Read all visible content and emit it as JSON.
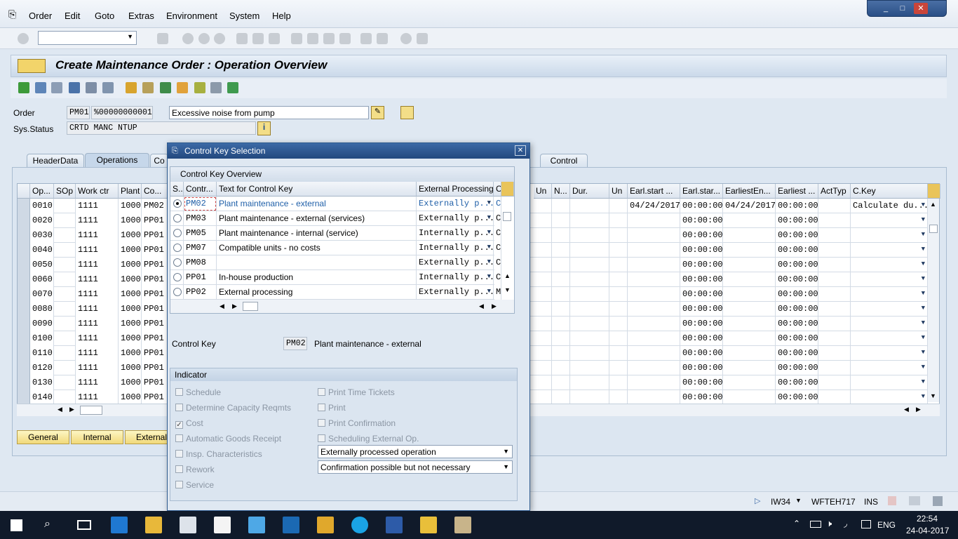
{
  "menu": [
    "Order",
    "Edit",
    "Goto",
    "Extras",
    "Environment",
    "System",
    "Help"
  ],
  "window_controls": [
    "_",
    "□",
    "✕"
  ],
  "page_title": "Create Maintenance Order : Operation Overview",
  "header": {
    "order_label": "Order",
    "order_type": "PM01",
    "order_number": "%00000000001",
    "order_desc": "Excessive noise from pump",
    "status_label": "Sys.Status",
    "status_value": "CRTD MANC NTUP"
  },
  "tabs": [
    "HeaderData",
    "Operations",
    "Co",
    "Control"
  ],
  "grid": {
    "columns": [
      "Op...",
      "SOp",
      "Work ctr",
      "Plant",
      "Co...",
      "Un",
      "N...",
      "Dur.",
      "Un",
      "Earl.start ...",
      "Earl.star...",
      "EarliestEn...",
      "Earliest ...",
      "ActTyp",
      "C.Key"
    ],
    "rows": [
      {
        "op": "0010",
        "wc": "1111",
        "plant": "1000",
        "ck": "PM02",
        "es": "04/24/2017",
        "est": "00:00:00",
        "ee": "04/24/2017",
        "eet": "00:00:00",
        "calc": "Calculate du..."
      },
      {
        "op": "0020",
        "wc": "1111",
        "plant": "1000",
        "ck": "PP01",
        "es": "",
        "est": "00:00:00",
        "ee": "",
        "eet": "00:00:00",
        "calc": ""
      },
      {
        "op": "0030",
        "wc": "1111",
        "plant": "1000",
        "ck": "PP01",
        "es": "",
        "est": "00:00:00",
        "ee": "",
        "eet": "00:00:00",
        "calc": ""
      },
      {
        "op": "0040",
        "wc": "1111",
        "plant": "1000",
        "ck": "PP01",
        "es": "",
        "est": "00:00:00",
        "ee": "",
        "eet": "00:00:00",
        "calc": ""
      },
      {
        "op": "0050",
        "wc": "1111",
        "plant": "1000",
        "ck": "PP01",
        "es": "",
        "est": "00:00:00",
        "ee": "",
        "eet": "00:00:00",
        "calc": ""
      },
      {
        "op": "0060",
        "wc": "1111",
        "plant": "1000",
        "ck": "PP01",
        "es": "",
        "est": "00:00:00",
        "ee": "",
        "eet": "00:00:00",
        "calc": ""
      },
      {
        "op": "0070",
        "wc": "1111",
        "plant": "1000",
        "ck": "PP01",
        "es": "",
        "est": "00:00:00",
        "ee": "",
        "eet": "00:00:00",
        "calc": ""
      },
      {
        "op": "0080",
        "wc": "1111",
        "plant": "1000",
        "ck": "PP01",
        "es": "",
        "est": "00:00:00",
        "ee": "",
        "eet": "00:00:00",
        "calc": ""
      },
      {
        "op": "0090",
        "wc": "1111",
        "plant": "1000",
        "ck": "PP01",
        "es": "",
        "est": "00:00:00",
        "ee": "",
        "eet": "00:00:00",
        "calc": ""
      },
      {
        "op": "0100",
        "wc": "1111",
        "plant": "1000",
        "ck": "PP01",
        "es": "",
        "est": "00:00:00",
        "ee": "",
        "eet": "00:00:00",
        "calc": ""
      },
      {
        "op": "0110",
        "wc": "1111",
        "plant": "1000",
        "ck": "PP01",
        "es": "",
        "est": "00:00:00",
        "ee": "",
        "eet": "00:00:00",
        "calc": ""
      },
      {
        "op": "0120",
        "wc": "1111",
        "plant": "1000",
        "ck": "PP01",
        "es": "",
        "est": "00:00:00",
        "ee": "",
        "eet": "00:00:00",
        "calc": ""
      },
      {
        "op": "0130",
        "wc": "1111",
        "plant": "1000",
        "ck": "PP01",
        "es": "",
        "est": "00:00:00",
        "ee": "",
        "eet": "00:00:00",
        "calc": ""
      },
      {
        "op": "0140",
        "wc": "1111",
        "plant": "1000",
        "ck": "PP01",
        "es": "",
        "est": "00:00:00",
        "ee": "",
        "eet": "00:00:00",
        "calc": ""
      }
    ]
  },
  "bottom_buttons": [
    "General",
    "Internal",
    "External"
  ],
  "dialog": {
    "title": "Control Key Selection",
    "close": "✕",
    "overview_title": "Control Key Overview",
    "columns": [
      "S..",
      "Contr...",
      "Text for Control Key",
      "External Processing",
      "C"
    ],
    "rows": [
      {
        "key": "PM02",
        "text": "Plant maintenance - external",
        "ext": "Externally p...",
        "c": "C",
        "selected": true
      },
      {
        "key": "PM03",
        "text": "Plant maintenance - external (services)",
        "ext": "Externally p...",
        "c": "C",
        "selected": false
      },
      {
        "key": "PM05",
        "text": "Plant maintenance - internal (service)",
        "ext": "Internally p...",
        "c": "C",
        "selected": false
      },
      {
        "key": "PM07",
        "text": "Compatible units - no costs",
        "ext": "Internally p...",
        "c": "C",
        "selected": false
      },
      {
        "key": "PM08",
        "text": "",
        "ext": "Externally p...",
        "c": "C",
        "selected": false
      },
      {
        "key": "PP01",
        "text": "In-house production",
        "ext": "Internally p...",
        "c": "C",
        "selected": false
      },
      {
        "key": "PP02",
        "text": "External processing",
        "ext": "Externally p...",
        "c": "M",
        "selected": false
      }
    ],
    "control_key_label": "Control Key",
    "control_key_value": "PM02",
    "control_key_text": "Plant maintenance - external",
    "indicator_title": "Indicator",
    "left_checks": [
      {
        "label": "Schedule",
        "checked": false
      },
      {
        "label": "Determine Capacity Reqmts",
        "checked": false
      },
      {
        "label": "Cost",
        "checked": true
      },
      {
        "label": "Automatic Goods Receipt",
        "checked": false
      },
      {
        "label": "Insp. Characteristics",
        "checked": false
      },
      {
        "label": "Rework",
        "checked": false
      },
      {
        "label": "Service",
        "checked": false
      }
    ],
    "right_checks": [
      {
        "label": "Print Time Tickets",
        "checked": false
      },
      {
        "label": "Print",
        "checked": false
      },
      {
        "label": "Print Confirmation",
        "checked": false
      },
      {
        "label": "Scheduling External Op.",
        "checked": false
      }
    ],
    "select_ext": "Externally processed operation",
    "select_conf": "Confirmation possible but not necessary"
  },
  "statusbar": {
    "tcode": "IW34",
    "server": "WFTEH717",
    "mode": "INS"
  },
  "taskbar": {
    "lang": "ENG",
    "time": "22:54",
    "date": "24-04-2017"
  },
  "colors": {
    "title_blue": "#22487e",
    "accent_yellow": "#f1d97a",
    "selected_text": "#1f5fa8"
  }
}
